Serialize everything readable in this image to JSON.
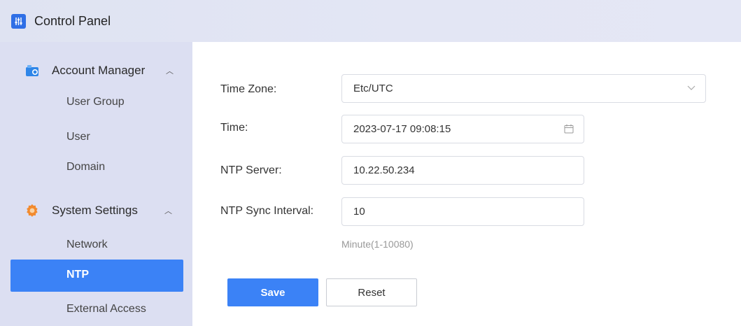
{
  "titlebar": {
    "title": "Control Panel",
    "icon": "sliders-icon"
  },
  "sidebar": {
    "groups": [
      {
        "label": "Account Manager",
        "icon": "account-manager-icon",
        "items": [
          "User Group",
          "User",
          "Domain"
        ]
      },
      {
        "label": "System Settings",
        "icon": "gear-icon",
        "items": [
          "Network",
          "NTP",
          "External Access"
        ]
      }
    ],
    "active_item": "NTP"
  },
  "form": {
    "time_zone": {
      "label": "Time Zone:",
      "value": "Etc/UTC"
    },
    "time": {
      "label": "Time:",
      "value": "2023-07-17 09:08:15"
    },
    "ntp_server": {
      "label": "NTP Server:",
      "value": "10.22.50.234"
    },
    "ntp_sync_interval": {
      "label": "NTP Sync Interval:",
      "value": "10",
      "hint": "Minute(1-10080)"
    }
  },
  "actions": {
    "save": "Save",
    "reset": "Reset"
  },
  "colors": {
    "primary": "#3b82f6",
    "sidebar_bg": "#dcdff2"
  }
}
